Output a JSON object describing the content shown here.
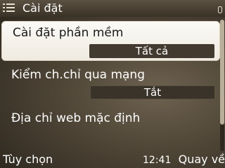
{
  "titlebar": {
    "title": "Cài đặt",
    "icon": "settings-list-icon",
    "signal_icon": "signal-indicator-icon"
  },
  "settings": [
    {
      "label": "Cài đặt phần mềm",
      "value": "Tất cả",
      "selected": true
    },
    {
      "label": "Kiểm ch.chỉ qua mạng",
      "value": "Tắt",
      "selected": false
    },
    {
      "label": "Địa chỉ web mặc định",
      "value": "",
      "selected": false
    }
  ],
  "softkeys": {
    "left": "Tùy chọn",
    "right": "Quay về",
    "clock": "12:41"
  },
  "colors": {
    "background": "#4e4536",
    "highlight": "#f6f3ec",
    "value_box": "#3a3329",
    "text": "#ffffff",
    "selected_text": "#1a1a1a"
  }
}
